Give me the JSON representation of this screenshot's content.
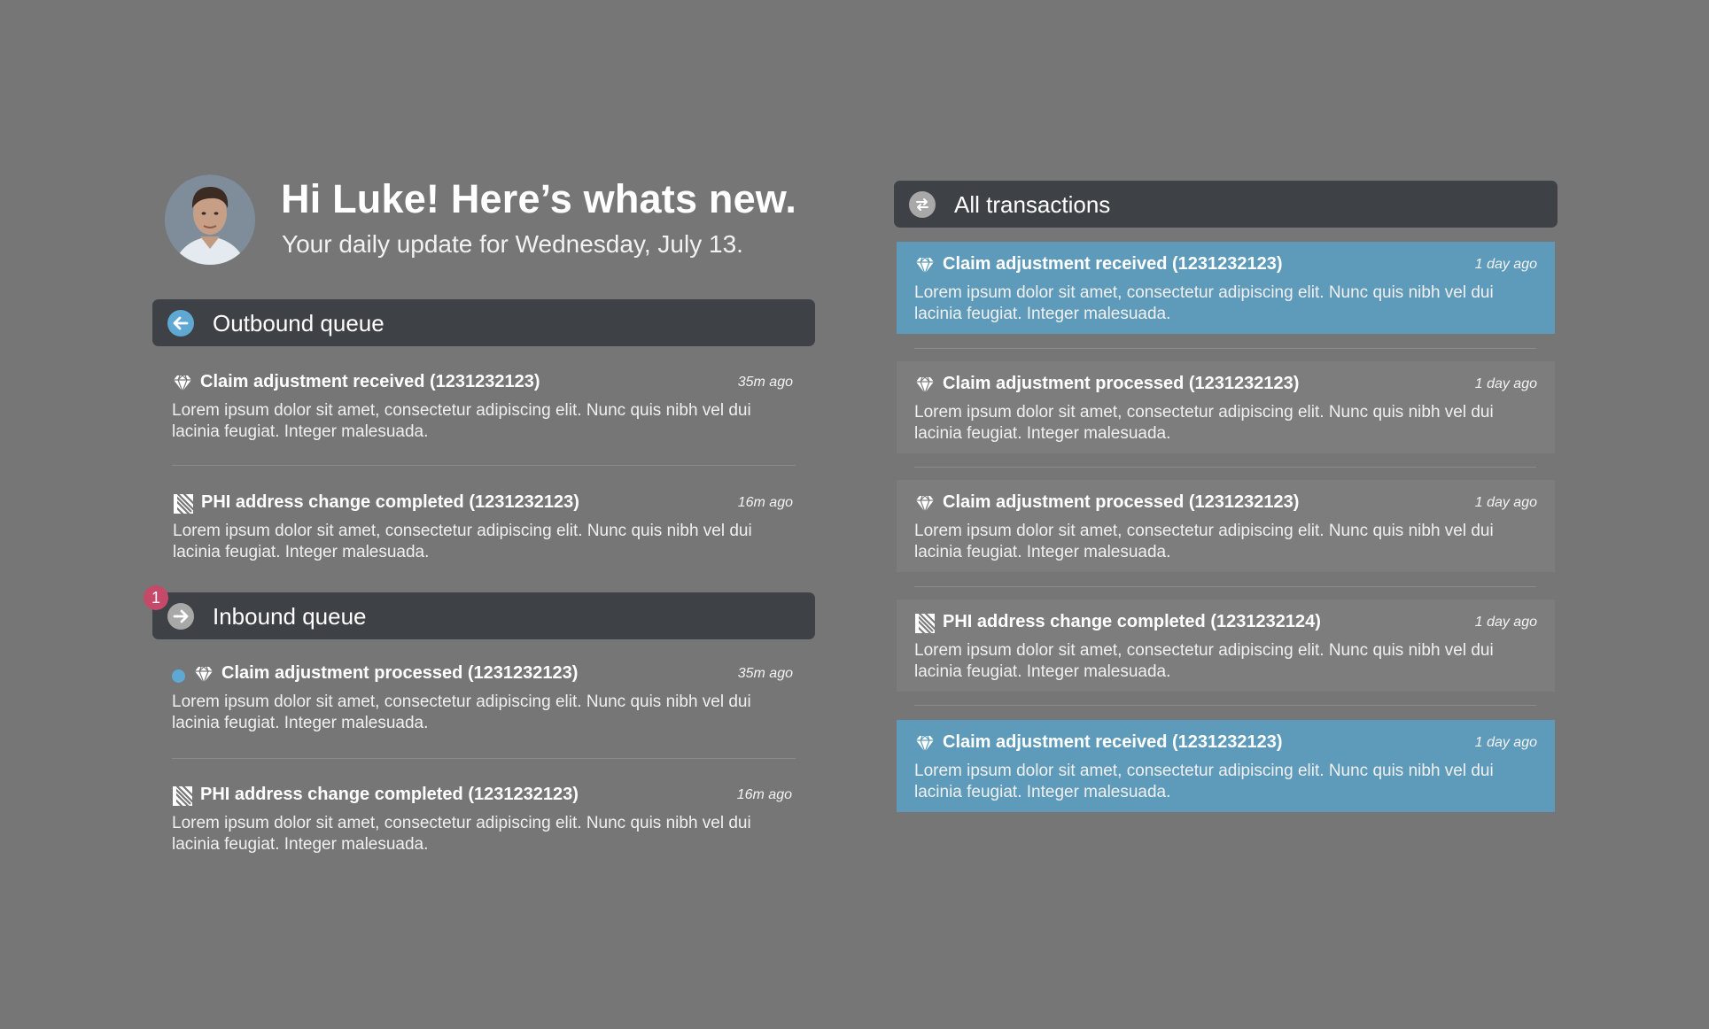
{
  "greeting": {
    "title": "Hi Luke! Here’s whats new.",
    "subtitle": "Your daily update for Wednesday, July 13."
  },
  "colors": {
    "background": "#767676",
    "header_bg": "#3e4145",
    "accent_blue": "#5e9bbb",
    "unread_dot": "#5fa8d3",
    "badge": "#c54a6a"
  },
  "outbound": {
    "label": "Outbound queue",
    "icon": "arrow-left-icon",
    "items": [
      {
        "icon": "diamond-icon",
        "title": "Claim adjustment received (1231232123)",
        "time": "35m ago",
        "body": "Lorem ipsum dolor sit amet, consectetur adipiscing elit. Nunc quis nibh vel dui lacinia feugiat. Integer malesuada."
      },
      {
        "icon": "striped-document-icon",
        "title": "PHI address change completed (1231232123)",
        "time": "16m ago",
        "body": "Lorem ipsum dolor sit amet, consectetur adipiscing elit. Nunc quis nibh vel dui lacinia feugiat. Integer malesuada."
      }
    ]
  },
  "inbound": {
    "label": "Inbound queue",
    "icon": "arrow-right-icon",
    "badge": "1",
    "items": [
      {
        "icon": "diamond-icon",
        "unread": true,
        "title": "Claim adjustment processed (1231232123)",
        "time": "35m ago",
        "body": "Lorem ipsum dolor sit amet, consectetur adipiscing elit. Nunc quis nibh vel dui lacinia feugiat. Integer malesuada."
      },
      {
        "icon": "striped-document-icon",
        "title": "PHI address change completed (1231232123)",
        "time": "16m ago",
        "body": "Lorem ipsum dolor sit amet, consectetur adipiscing elit. Nunc quis nibh vel dui lacinia feugiat. Integer malesuada."
      }
    ]
  },
  "all": {
    "label": "All transactions",
    "icon": "exchange-arrows-icon",
    "items": [
      {
        "icon": "diamond-icon",
        "highlight": true,
        "title": "Claim adjustment received (1231232123)",
        "time": "1 day ago",
        "body": "Lorem ipsum dolor sit amet, consectetur adipiscing elit. Nunc quis nibh vel dui lacinia feugiat. Integer malesuada."
      },
      {
        "icon": "diamond-icon",
        "title": "Claim adjustment processed (1231232123)",
        "time": "1 day ago",
        "body": "Lorem ipsum dolor sit amet, consectetur adipiscing elit. Nunc quis nibh vel dui lacinia feugiat. Integer malesuada."
      },
      {
        "icon": "diamond-icon",
        "title": "Claim adjustment processed (1231232123)",
        "time": "1 day ago",
        "body": "Lorem ipsum dolor sit amet, consectetur adipiscing elit. Nunc quis nibh vel dui lacinia feugiat. Integer malesuada."
      },
      {
        "icon": "striped-document-icon",
        "title": "PHI address change completed (1231232124)",
        "time": "1 day ago",
        "body": "Lorem ipsum dolor sit amet, consectetur adipiscing elit. Nunc quis nibh vel dui lacinia feugiat. Integer malesuada."
      },
      {
        "icon": "diamond-icon",
        "highlight": true,
        "title": "Claim adjustment received (1231232123)",
        "time": "1 day ago",
        "body": "Lorem ipsum dolor sit amet, consectetur adipiscing elit. Nunc quis nibh vel dui lacinia feugiat. Integer malesuada."
      }
    ]
  }
}
